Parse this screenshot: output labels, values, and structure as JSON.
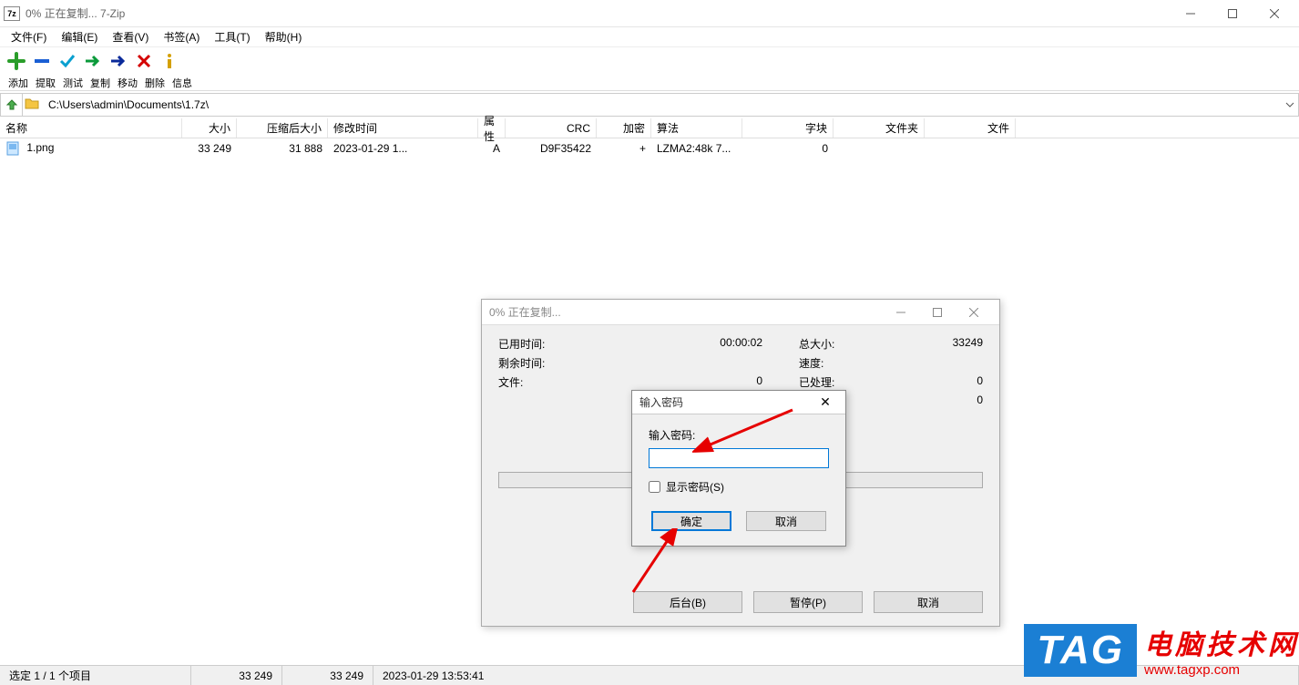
{
  "titlebar": {
    "icon": "7z",
    "title": "0% 正在复制... 7-Zip"
  },
  "menu": {
    "file": "文件(F)",
    "edit": "编辑(E)",
    "view": "查看(V)",
    "bookmark": "书签(A)",
    "tools": "工具(T)",
    "help": "帮助(H)"
  },
  "toolbar_labels": {
    "add": "添加",
    "extract": "提取",
    "test": "测试",
    "copy": "复制",
    "move": "移动",
    "delete": "删除",
    "info": "信息"
  },
  "path": "C:\\Users\\admin\\Documents\\1.7z\\",
  "columns": {
    "name": "名称",
    "size": "大小",
    "packed": "压缩后大小",
    "mtime": "修改时间",
    "attr": "属性",
    "crc": "CRC",
    "enc": "加密",
    "algo": "算法",
    "block": "字块",
    "folder": "文件夹",
    "file": "文件"
  },
  "rows": [
    {
      "name": "1.png",
      "size": "33 249",
      "packed": "31 888",
      "mtime": "2023-01-29 1...",
      "attr": "A",
      "crc": "D9F35422",
      "enc": "+",
      "algo": "LZMA2:48k 7...",
      "block": "0",
      "folder": "",
      "file": ""
    }
  ],
  "status": {
    "selection": "选定 1 / 1 个项目",
    "size1": "33 249",
    "size2": "33 249",
    "datetime": "2023-01-29 13:53:41"
  },
  "progress": {
    "title": "0% 正在复制...",
    "elapsed_lbl": "已用时间:",
    "elapsed_val": "00:00:02",
    "remain_lbl": "剩余时间:",
    "remain_val": "",
    "files_lbl": "文件:",
    "files_val": "0",
    "total_lbl": "总大小:",
    "total_val": "33249",
    "speed_lbl": "速度:",
    "speed_val": "",
    "proc_lbl": "已处理:",
    "proc_val": "0",
    "extra_val": "0",
    "btn_bg": "后台(B)",
    "btn_pause": "暂停(P)",
    "btn_cancel": "取消"
  },
  "pwd": {
    "title": "输入密码",
    "label": "输入密码:",
    "show": "显示密码(S)",
    "ok": "确定",
    "cancel": "取消"
  },
  "watermark": {
    "tag": "TAG",
    "line1": "电脑技术网",
    "line2": "www.tagxp.com"
  }
}
